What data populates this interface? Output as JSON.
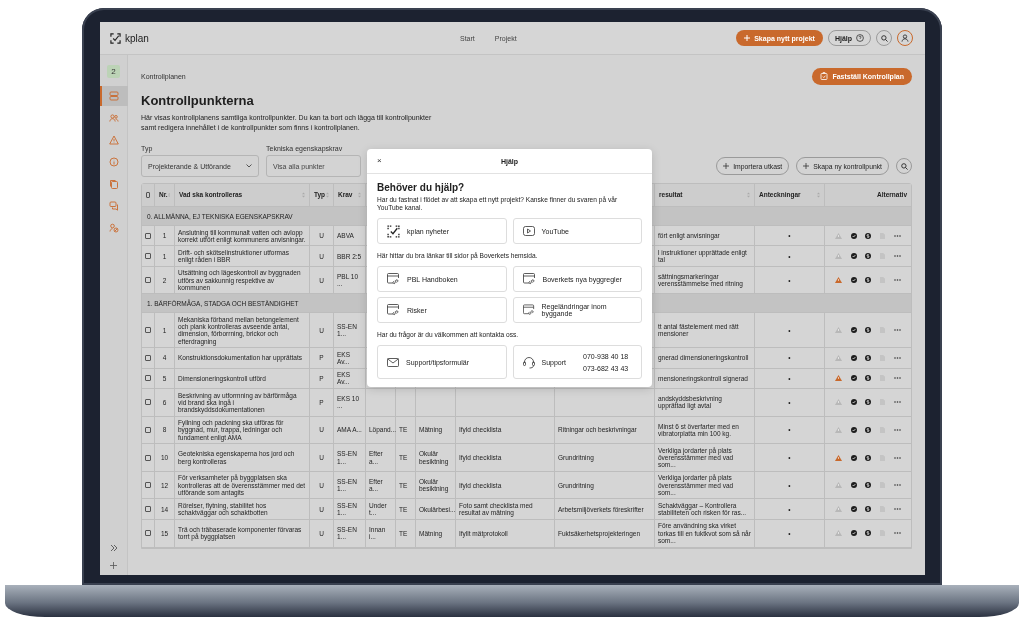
{
  "top_bar": {
    "logo": "kplan",
    "nav": [
      {
        "label": "Start",
        "selected": false
      },
      {
        "label": "Projekt",
        "selected": false
      }
    ],
    "create_button": "Skapa nytt projekt",
    "help_button": "Hjälp"
  },
  "sidebar": {
    "badge": "2",
    "items": [
      {
        "selected": true
      },
      {
        "selected": false
      },
      {
        "selected": false
      },
      {
        "selected": false
      },
      {
        "selected": false
      },
      {
        "selected": false
      },
      {
        "selected": false
      }
    ]
  },
  "breadcrumb": "Kontrollplanen",
  "confirm_button": "Fastställ Kontrollplan",
  "title": "Kontrollpunkterna",
  "description": "Här visas kontrollplanens samtliga kontrollpunkter. Du kan ta bort och lägga till kontrollpunkter samt redigera innehållet i de kontrollpunkter som finns i kontrollplanen.",
  "filters": {
    "type_label": "Typ",
    "type_value": "Projekterande & Utförande",
    "tech_label": "Tekniska egenskapskrav",
    "tech_placeholder": "Visa alla punkter"
  },
  "actions": [
    "Importera utkast",
    "Skapa ny kontrollpunkt"
  ],
  "table": {
    "select_all": {
      "checked": false
    },
    "columns": [
      {
        "label": "Nr."
      },
      {
        "label": "Vad ska kontrolleras"
      },
      {
        "label": "Typ"
      },
      {
        "label": "Krav"
      },
      {
        "label": "resultat"
      },
      {
        "label": "Anteckningar"
      },
      {
        "label": "Alternativ"
      }
    ],
    "rows": [
      {
        "kind": "group",
        "label": "0. ALLMÄNNA, EJ TEKNISKA EGENSKAPSKRAV"
      },
      {
        "kind": "item",
        "checked": false,
        "nr": "1",
        "what": "Anslutning till kommunalt vatten och avlopp korrekt utfört enligt kommunens anvisningar.",
        "type": "U",
        "requirement": "ABVA",
        "result": "fört enligt anvisningar",
        "notes": "•",
        "warning": false
      },
      {
        "kind": "item",
        "checked": false,
        "nr": "1",
        "what": "Drift- och skötselinstruktioner utformas enligt råden i BBR",
        "type": "U",
        "requirement": "BBR 2:5",
        "result": "l instruktioner upprättade enligt tal",
        "notes": "•",
        "warning": false
      },
      {
        "kind": "item",
        "checked": false,
        "nr": "2",
        "what": "Utsättning och lägeskontroll av byggnaden utförs av sakkunnig respektive av kommunen",
        "type": "U",
        "requirement": "PBL 10 ...",
        "result": "sättningsmarkeringar verensstämmelse med ritning",
        "notes": "•",
        "warning": true
      },
      {
        "kind": "group",
        "label": "1. BÄRFÖRMÅGA, STADGA OCH BESTÄNDIGHET"
      },
      {
        "kind": "item",
        "checked": false,
        "nr": "1",
        "what": "Mekaniska förband mellan betongelement och plank kontrolleras avseende antal, dimension, förborrning, brickor och efterdragning",
        "type": "U",
        "requirement": "SS-EN 1...",
        "result": "tt antal fästelement med rätt mensioner",
        "notes": "•",
        "warning": false
      },
      {
        "kind": "item",
        "checked": false,
        "nr": "4",
        "what": "Konstruktionsdokumentation har upprättats",
        "type": "P",
        "requirement": "EKS Av...",
        "result": "gnerad dimensioneringskontroll",
        "notes": "•",
        "warning": false
      },
      {
        "kind": "item",
        "checked": false,
        "nr": "5",
        "what": "Dimensioneringskontroll utförd",
        "type": "P",
        "requirement": "EKS Av...",
        "result": "mensioneringskontroll signerad",
        "notes": "•",
        "warning": true
      },
      {
        "kind": "item",
        "checked": false,
        "nr": "6",
        "what": "Beskrivning av utformning av bärförmåga vid brand ska ingå i brandskyddsdokumentationen",
        "type": "P",
        "requirement": "EKS 10 ...",
        "result": "andskyddsbeskrivning upprättad ligt avtal",
        "notes": "•",
        "warning": false
      },
      {
        "kind": "item",
        "checked": false,
        "nr": "8",
        "what": "Fyllning och packning ska utföras för byggnad, mur, trappa, ledningar och fundament enligt AMA",
        "type": "U",
        "requirement": "AMA A...",
        "column_5": "Löpand...",
        "column_6": "TE",
        "column_7": "Mätning",
        "column_8": "Ifyld checklista",
        "column_9": "Ritningar och beskrivningar",
        "result": "Minst 6 st överfarter med en vibratorplatta min 100 kg.",
        "notes": "•",
        "warning": false
      },
      {
        "kind": "item",
        "checked": false,
        "nr": "10",
        "what": "Geotekniska egenskaperna hos jord och berg kontrolleras",
        "type": "U",
        "requirement": "SS-EN 1...",
        "column_5": "Efter a...",
        "column_6": "TE",
        "column_7": "Okulär besiktning",
        "column_8": "Ifyld checklista",
        "column_9": "Grundritning",
        "result": "Verkliga jordarter på plats överensstämmer med vad som...",
        "notes": "•",
        "warning": true
      },
      {
        "kind": "item",
        "checked": false,
        "nr": "12",
        "what": "För verksamheter på byggplatsen ska kontrolleras att de överensstämmer med det utförande som antagits",
        "type": "U",
        "requirement": "SS-EN 1...",
        "column_5": "Efter a...",
        "column_6": "TE",
        "column_7": "Okulär besiktning",
        "column_8": "Ifyld checklista",
        "column_9": "Grundritning",
        "result": "Verkliga jordarter på plats överensstämmer med vad som...",
        "notes": "•",
        "warning": false
      },
      {
        "kind": "item",
        "checked": false,
        "nr": "14",
        "what": "Rörelser, flytning, stabilitet hos schaktväggar och schaktbotten",
        "type": "U",
        "requirement": "SS-EN 1...",
        "column_5": "Under t...",
        "column_6": "TE",
        "column_7": "Okulärbesi...",
        "column_8": "Foto samt checklista med resultat av mätning",
        "column_9": "Arbetsmiljöverkets föreskrifter",
        "result": "Schaktväggar – Kontrollera stabiliteten och risken för ras...",
        "notes": "•",
        "warning": false
      },
      {
        "kind": "item",
        "checked": false,
        "nr": "15",
        "what": "Trä och träbaserade komponenter förvaras torrt på byggplatsen",
        "type": "U",
        "requirement": "SS-EN 1...",
        "column_5": "Innan i...",
        "column_6": "TE",
        "column_7": "Mätning",
        "column_8": "Ifyllt mätprotokoll",
        "column_9": "Fuktsäkerhetsprojekteringen",
        "result": "Före användning ska virket torkas till en fuktkvot som så når som...",
        "notes": "•",
        "warning": false
      }
    ]
  },
  "help": {
    "close": "×",
    "title": "Hjälp",
    "heading": "Behöver du hjälp?",
    "sections": [
      {
        "text": "Har du fastnat i flödet av att skapa ett nytt projekt? Kanske finner du svaren på vår YouTube kanal.",
        "cards": [
          {
            "kind": "news",
            "label": "kplan nyheter"
          },
          {
            "kind": "video",
            "label": "YouTube"
          }
        ]
      },
      {
        "text": "Här hittar du bra länkar till sidor på Boverkets hemsida.",
        "cards": [
          {
            "kind": "link",
            "label": "PBL Handboken"
          },
          {
            "kind": "link",
            "label": "Boverkets nya byggregler"
          },
          {
            "kind": "link",
            "label": "Risker"
          },
          {
            "kind": "link",
            "label": "Regeländringar inom byggande"
          }
        ]
      },
      {
        "text": "Har du frågor är du välkommen att kontakta oss.",
        "cards": [
          {
            "kind": "mail",
            "label": "Support/tipsformulär"
          },
          {
            "kind": "phone",
            "label": "Support",
            "phones": [
              "070-938 40 18",
              "073-682 43 43"
            ]
          }
        ]
      }
    ]
  }
}
